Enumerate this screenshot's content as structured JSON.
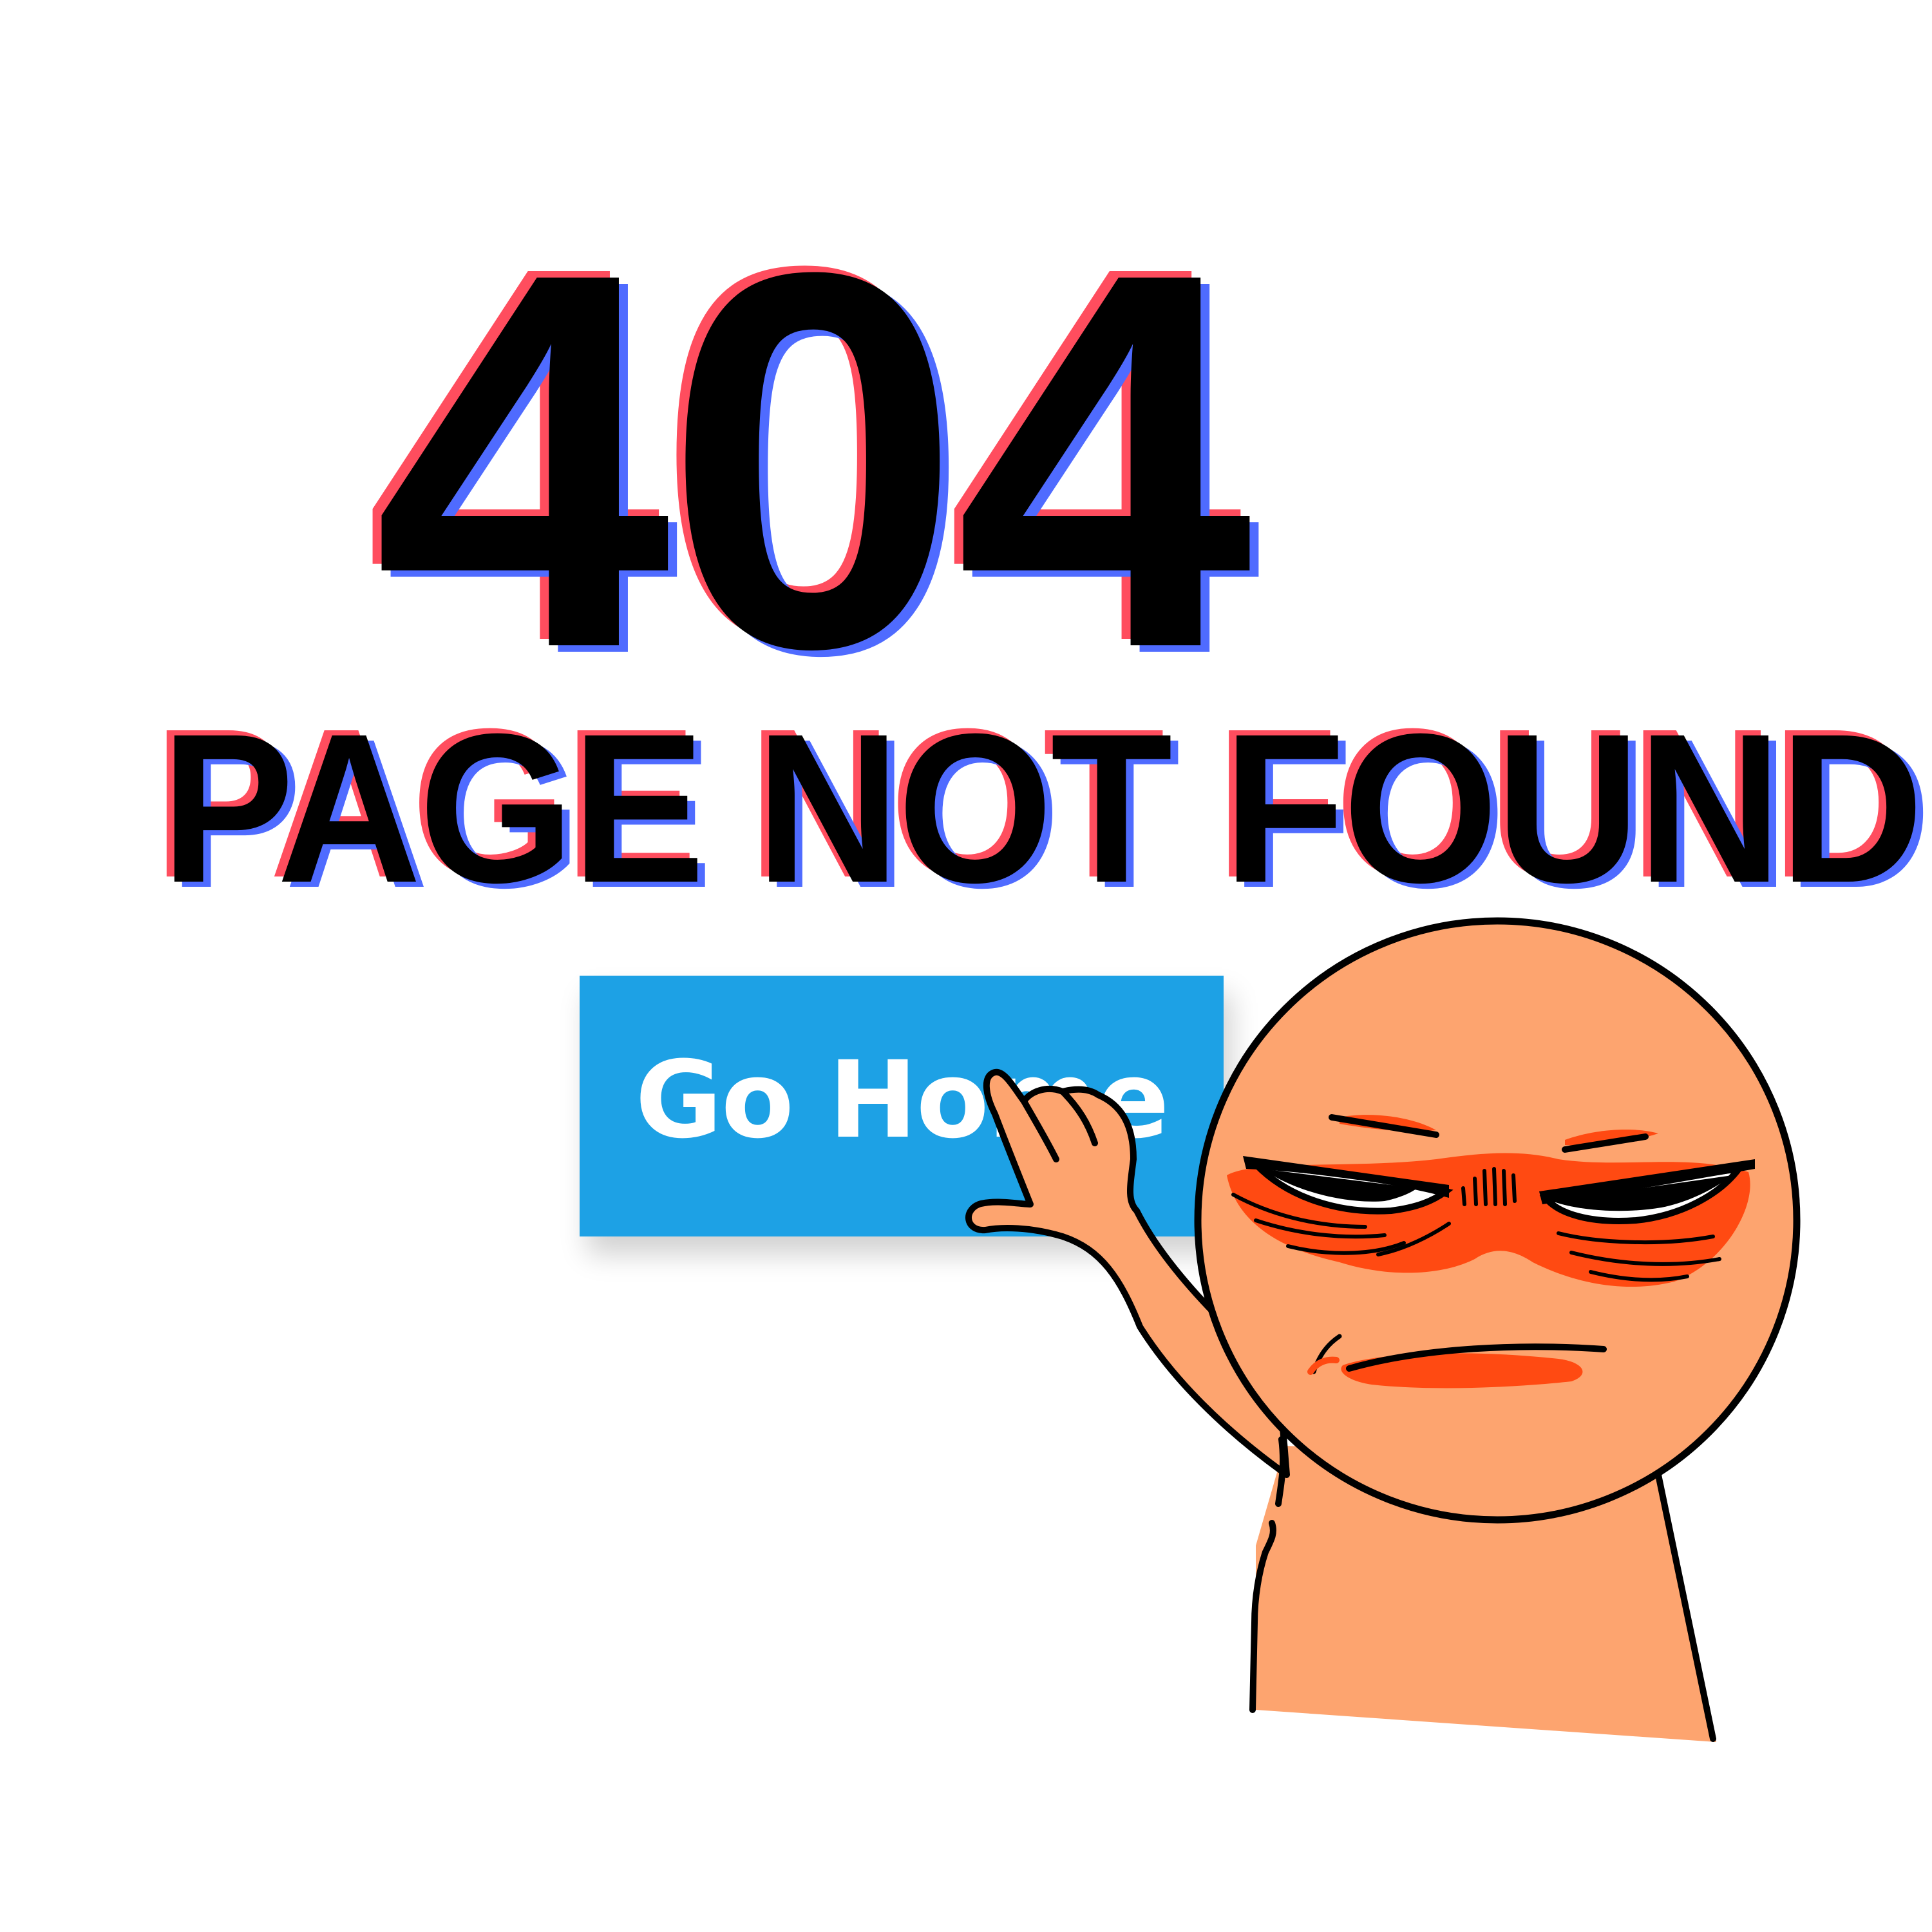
{
  "error": {
    "code": "404",
    "message": "PAGE NOT FOUND"
  },
  "actions": {
    "home_label": "Go Home"
  },
  "colors": {
    "glitch_red": "#ff4d5e",
    "glitch_blue": "#4f6bff",
    "button": "#1da1e5",
    "character_skin": "#fda46f",
    "character_blush": "#ff4a12"
  },
  "illustration": {
    "icon": "annoyed-pointing-character"
  }
}
